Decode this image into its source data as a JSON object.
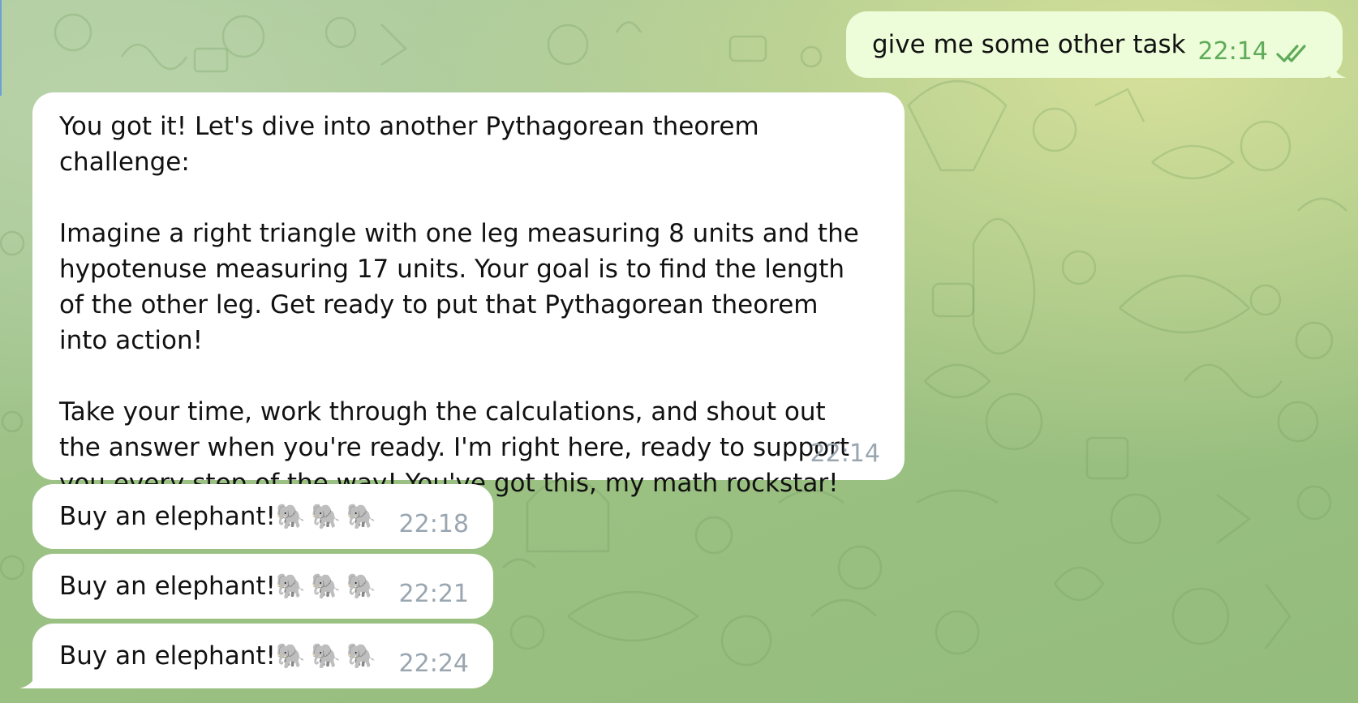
{
  "colors": {
    "incoming_bubble": "#ffffff",
    "outgoing_bubble": "#eefdd9",
    "outgoing_time": "#5fab5a",
    "incoming_time": "#9aa6b0"
  },
  "messages": [
    {
      "direction": "out",
      "text": "give me some other task",
      "time": "22:14",
      "status_icon": "double-check-icon"
    },
    {
      "direction": "in",
      "text": "You got it! Let's dive into another Pythagorean theorem challenge:\n\nImagine a right triangle with one leg measuring 8 units and the hypotenuse measuring 17 units. Your goal is to find the length of the other leg. Get ready to put that Pythagorean theorem into action!\n\nTake your time, work through the calculations, and shout out the answer when you're ready. I'm right here, ready to support you every step of the way! You've got this, my math rockstar!",
      "time": "22:14"
    },
    {
      "direction": "in",
      "text": "Buy an elephant!",
      "emoji": "🐘🐘🐘",
      "time": "22:18"
    },
    {
      "direction": "in",
      "text": "Buy an elephant!",
      "emoji": "🐘🐘🐘",
      "time": "22:21"
    },
    {
      "direction": "in",
      "text": "Buy an elephant!",
      "emoji": "🐘🐘🐘",
      "time": "22:24"
    }
  ]
}
